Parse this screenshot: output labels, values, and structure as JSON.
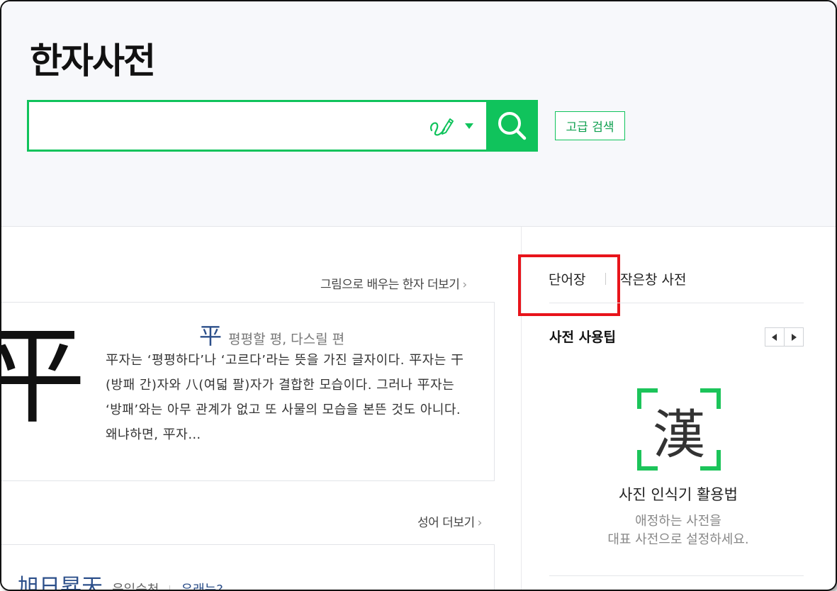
{
  "header": {
    "title": "한자사전",
    "search": {
      "value": "",
      "placeholder": ""
    },
    "advanced_search_label": "고급 검색"
  },
  "picture_hanja": {
    "more_label": "그림으로 배우는 한자 더보기",
    "big_glyph": "平",
    "hanja": "平",
    "reading": "평평할 평, 다스릴 편",
    "description": "平자는 ‘평평하다’나 ‘고르다’라는 뜻을 가진 글자이다. 平자는 干(방패 간)자와 八(여덟 팔)자가 결합한 모습이다. 그러나 平자는 ‘방패’와는 아무 관계가 없고 또 사물의 모습을 본뜬 것도 아니다. 왜냐하면, 平자…"
  },
  "idiom": {
    "more_label": "성어 더보기",
    "hanja": "旭日昇天",
    "reading": "욱일승천",
    "link_label": "유래는?"
  },
  "sidebar": {
    "tabs": [
      {
        "label": "단어장"
      },
      {
        "label": "작은창 사전"
      }
    ],
    "tips_title": "사전 사용팁",
    "tip": {
      "icon_char": "漢",
      "title": "사진 인식기 활용법",
      "desc_line1": "애정하는 사전을",
      "desc_line2": "대표 사전으로 설정하세요."
    }
  },
  "colors": {
    "brand_green": "#10c35c",
    "highlight_red": "#e8141b",
    "hanja_blue": "#2c4f8a"
  }
}
